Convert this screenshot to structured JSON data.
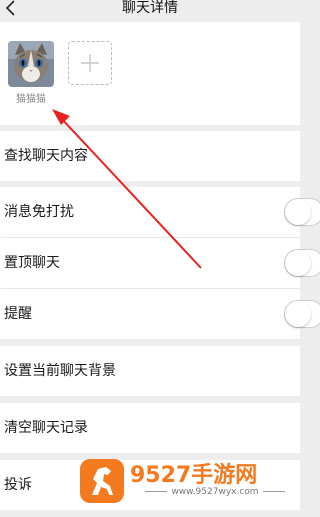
{
  "header": {
    "title": "聊天详情",
    "back_icon": "chevron-left-icon"
  },
  "members": [
    {
      "name": "猫猫猫",
      "avatar": "cat-avatar"
    }
  ],
  "add_member_icon": "plus-icon",
  "rows": {
    "search": "查找聊天内容",
    "mute": "消息免打扰",
    "pin": "置顶聊天",
    "remind": "提醒",
    "background": "设置当前聊天背景",
    "clear": "清空聊天记录",
    "report": "投诉"
  },
  "annotation": {
    "arrow_color": "#e8231d"
  },
  "watermark": {
    "brand": "9527手游网",
    "url": "www.9527wyx.com",
    "color": "#f47a20"
  }
}
